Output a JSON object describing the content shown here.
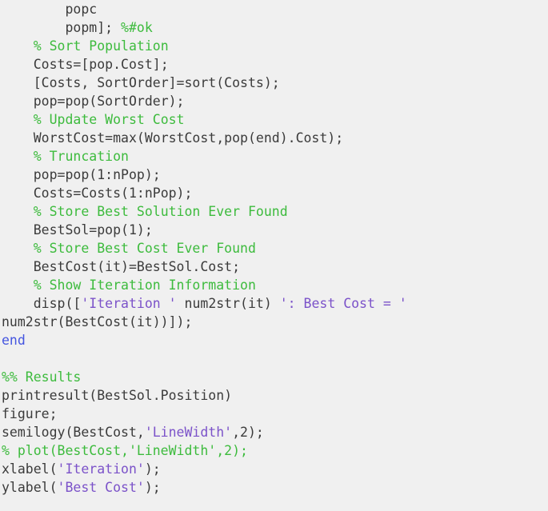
{
  "editor": {
    "name": "matlab-code-listing",
    "language": "MATLAB",
    "background_color": "#f0f0f0",
    "colors": {
      "plain": "#3b3b3b",
      "comment": "#3dbb3d",
      "string": "#7b52c9",
      "keyword": "#4556e0"
    }
  },
  "lines": [
    {
      "indent": 8,
      "tokens": [
        {
          "type": "plain",
          "text": "popc"
        }
      ]
    },
    {
      "indent": 8,
      "tokens": [
        {
          "type": "plain",
          "text": "popm]; "
        },
        {
          "type": "comment",
          "text": "%#ok"
        }
      ]
    },
    {
      "indent": 4,
      "tokens": [
        {
          "type": "comment",
          "text": "% Sort Population"
        }
      ]
    },
    {
      "indent": 4,
      "tokens": [
        {
          "type": "plain",
          "text": "Costs=[pop.Cost];"
        }
      ]
    },
    {
      "indent": 4,
      "tokens": [
        {
          "type": "plain",
          "text": "[Costs, SortOrder]=sort(Costs);"
        }
      ]
    },
    {
      "indent": 4,
      "tokens": [
        {
          "type": "plain",
          "text": "pop=pop(SortOrder);"
        }
      ]
    },
    {
      "indent": 4,
      "tokens": [
        {
          "type": "comment",
          "text": "% Update Worst Cost"
        }
      ]
    },
    {
      "indent": 4,
      "tokens": [
        {
          "type": "plain",
          "text": "WorstCost=max(WorstCost,pop(end).Cost);"
        }
      ]
    },
    {
      "indent": 4,
      "tokens": [
        {
          "type": "comment",
          "text": "% Truncation"
        }
      ]
    },
    {
      "indent": 4,
      "tokens": [
        {
          "type": "plain",
          "text": "pop=pop(1:nPop);"
        }
      ]
    },
    {
      "indent": 4,
      "tokens": [
        {
          "type": "plain",
          "text": "Costs=Costs(1:nPop);"
        }
      ]
    },
    {
      "indent": 4,
      "tokens": [
        {
          "type": "comment",
          "text": "% Store Best Solution Ever Found"
        }
      ]
    },
    {
      "indent": 4,
      "tokens": [
        {
          "type": "plain",
          "text": "BestSol=pop(1);"
        }
      ]
    },
    {
      "indent": 4,
      "tokens": [
        {
          "type": "comment",
          "text": "% Store Best Cost Ever Found"
        }
      ]
    },
    {
      "indent": 4,
      "tokens": [
        {
          "type": "plain",
          "text": "BestCost(it)=BestSol.Cost;"
        }
      ]
    },
    {
      "indent": 4,
      "tokens": [
        {
          "type": "comment",
          "text": "% Show Iteration Information"
        }
      ]
    },
    {
      "indent": 4,
      "tokens": [
        {
          "type": "plain",
          "text": "disp(["
        },
        {
          "type": "string",
          "text": "'Iteration '"
        },
        {
          "type": "plain",
          "text": " num2str(it) "
        },
        {
          "type": "string",
          "text": "': Best Cost = '"
        }
      ]
    },
    {
      "indent": 0,
      "tokens": [
        {
          "type": "plain",
          "text": "num2str(BestCost(it))]);"
        }
      ]
    },
    {
      "indent": 0,
      "tokens": [
        {
          "type": "keyword",
          "text": "end"
        }
      ]
    },
    {
      "indent": 0,
      "blank": true,
      "tokens": []
    },
    {
      "indent": 0,
      "tokens": [
        {
          "type": "comment",
          "text": "%% Results"
        }
      ]
    },
    {
      "indent": 0,
      "tokens": [
        {
          "type": "plain",
          "text": "printresult(BestSol.Position)"
        }
      ]
    },
    {
      "indent": 0,
      "tokens": [
        {
          "type": "plain",
          "text": "figure;"
        }
      ]
    },
    {
      "indent": 0,
      "tokens": [
        {
          "type": "plain",
          "text": "semilogy(BestCost,"
        },
        {
          "type": "string",
          "text": "'LineWidth'"
        },
        {
          "type": "plain",
          "text": ",2);"
        }
      ]
    },
    {
      "indent": 0,
      "tokens": [
        {
          "type": "comment",
          "text": "% plot(BestCost,'LineWidth',2);"
        }
      ]
    },
    {
      "indent": 0,
      "tokens": [
        {
          "type": "plain",
          "text": "xlabel("
        },
        {
          "type": "string",
          "text": "'Iteration'"
        },
        {
          "type": "plain",
          "text": ");"
        }
      ]
    },
    {
      "indent": 0,
      "tokens": [
        {
          "type": "plain",
          "text": "ylabel("
        },
        {
          "type": "string",
          "text": "'Best Cost'"
        },
        {
          "type": "plain",
          "text": ");"
        }
      ]
    }
  ]
}
